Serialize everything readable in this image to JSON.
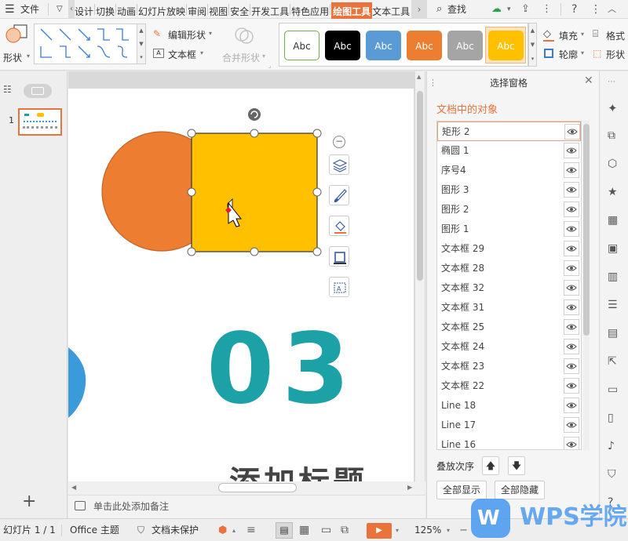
{
  "menubar": {
    "menu_label": "文件",
    "tabs": [
      "设计",
      "切换",
      "动画",
      "幻灯片放映",
      "审阅",
      "视图",
      "安全",
      "开发工具",
      "特色应用",
      "绘图工具",
      "文本工具"
    ],
    "active_tab": "绘图工具",
    "search_label": "查找"
  },
  "ribbon": {
    "shape_label": "形状",
    "edit_shape_label": "编辑形状",
    "textbox_label": "文本框",
    "merge_shape_label": "合并形状",
    "style_presets": [
      {
        "label": "Abc",
        "bg": "#ffffff",
        "fg": "#333333",
        "border": "#70ad47"
      },
      {
        "label": "Abc",
        "bg": "#000000",
        "fg": "#ffffff",
        "border": "#000000"
      },
      {
        "label": "Abc",
        "bg": "#5b9bd5",
        "fg": "#ffffff",
        "border": "#5b9bd5"
      },
      {
        "label": "Abc",
        "bg": "#ed7d31",
        "fg": "#ffffff",
        "border": "#ed7d31"
      },
      {
        "label": "Abc",
        "bg": "#a5a5a5",
        "fg": "#ffffff",
        "border": "#a5a5a5"
      },
      {
        "label": "Abc",
        "bg": "#ffc000",
        "fg": "#ffffff",
        "border": "#ffc000"
      }
    ],
    "fill_label": "填充",
    "outline_label": "轮廓",
    "format_label": "格式",
    "shape_effect_label": "形状"
  },
  "thumbnails": {
    "slide_number": "1"
  },
  "slide": {
    "circle_color": "#ed7d31",
    "rect_color": "#ffc000",
    "big_number": "03",
    "number_color": "#1ba1a6",
    "title_text": "添加标题",
    "blue_color": "#3b9ad9"
  },
  "notes": {
    "placeholder": "单击此处添加备注"
  },
  "selection_pane": {
    "title": "选择窗格",
    "section_title": "文档中的对象",
    "objects": [
      "矩形 2",
      "椭圆 1",
      "序号4",
      "图形 3",
      "图形 2",
      "图形 1",
      "文本框 29",
      "文本框 28",
      "文本框 32",
      "文本框 31",
      "文本框 25",
      "文本框 24",
      "文本框 23",
      "文本框 22",
      "Line 18",
      "Line 17",
      "Line 16"
    ],
    "order_label": "叠放次序",
    "show_all_label": "全部显示",
    "hide_all_label": "全部隐藏"
  },
  "statusbar": {
    "slide_info": "幻灯片 1 / 1",
    "theme": "Office 主题",
    "protect": "文档未保护",
    "zoom": "125%"
  },
  "watermark": {
    "text": "WPS学院"
  },
  "colors": {
    "accent": "#e9733b"
  }
}
